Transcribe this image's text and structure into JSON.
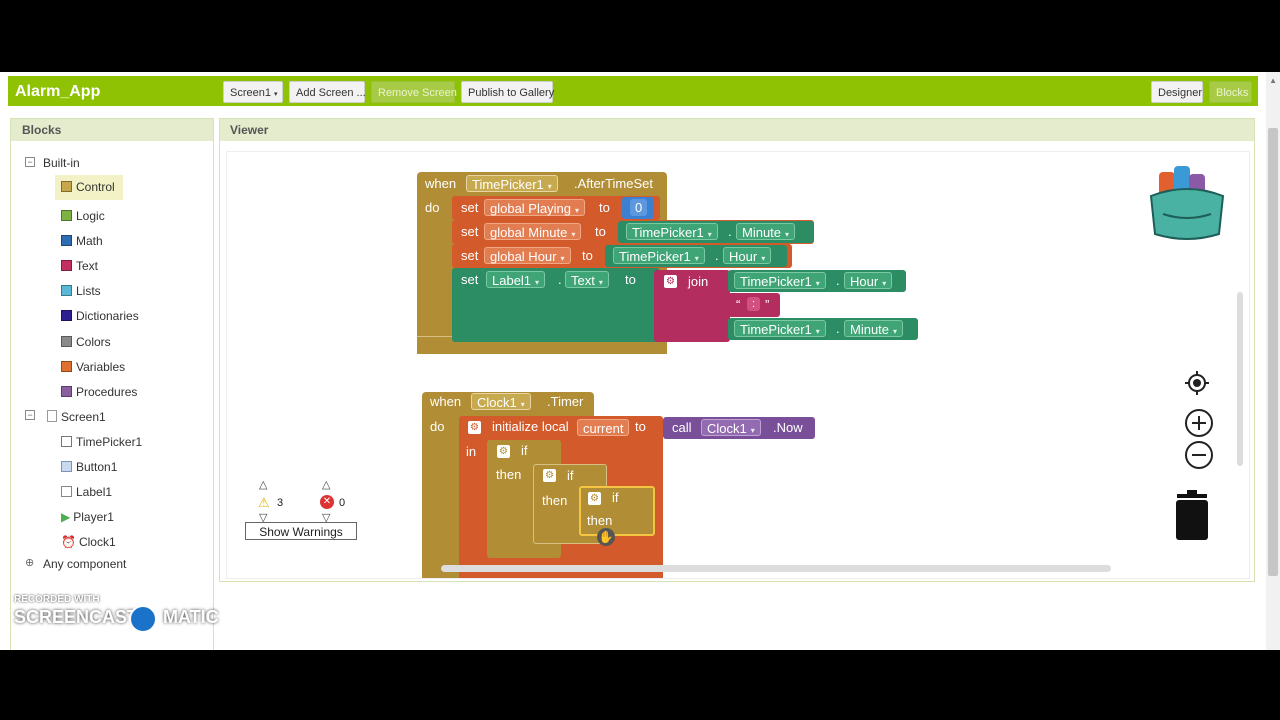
{
  "app": {
    "title": "Alarm_App",
    "screen_select": "Screen1",
    "add_screen": "Add Screen ...",
    "remove_screen": "Remove Screen",
    "publish": "Publish to Gallery",
    "designer": "Designer",
    "blocks": "Blocks"
  },
  "blocks_panel": {
    "title": "Blocks",
    "builtin": "Built-in",
    "categories": [
      {
        "label": "Control",
        "color": "#c8a64a"
      },
      {
        "label": "Logic",
        "color": "#7cb342"
      },
      {
        "label": "Math",
        "color": "#2f6db3"
      },
      {
        "label": "Text",
        "color": "#c2305f"
      },
      {
        "label": "Lists",
        "color": "#59b8d6"
      },
      {
        "label": "Dictionaries",
        "color": "#2d1f8f"
      },
      {
        "label": "Colors",
        "color": "#8a8a8a"
      },
      {
        "label": "Variables",
        "color": "#e0702e"
      },
      {
        "label": "Procedures",
        "color": "#8a5fa0"
      }
    ],
    "screen": "Screen1",
    "components": [
      "TimePicker1",
      "Button1",
      "Label1",
      "Player1",
      "Clock1"
    ],
    "any_component": "Any component"
  },
  "viewer": {
    "title": "Viewer",
    "event1": {
      "when": "when",
      "component": "TimePicker1",
      "event": ".AfterTimeSet",
      "do": "do",
      "set": "set",
      "to": "to",
      "dot": ".",
      "var_playing": "global Playing",
      "value_zero": "0",
      "var_minute": "global Minute",
      "tp1": "TimePicker1",
      "prop_minute": "Minute",
      "var_hour": "global Hour",
      "prop_hour": "Hour",
      "label": "Label1",
      "prop_text": "Text",
      "join": "join",
      "colon": ":"
    },
    "event2": {
      "when": "when",
      "component": "Clock1",
      "event": ".Timer",
      "do": "do",
      "init_local": "initialize local",
      "local_name": "current",
      "to": "to",
      "call": "call",
      "call_component": "Clock1",
      "call_method": ".Now",
      "in": "in",
      "if": "if",
      "then": "then"
    },
    "warnings_count": "3",
    "errors_count": "0",
    "show_warnings": "Show Warnings"
  },
  "watermark": {
    "line1": "RECORDED WITH",
    "line2": "SCREENCAST",
    "line3": "MATIC"
  },
  "colors": {
    "brand": "#8fc202",
    "control": "#b18e35",
    "variables": "#d35b2b",
    "component": "#2c8c63",
    "text": "#b32d5e",
    "math": "#3d7fd1",
    "procedure": "#7a4f9a"
  }
}
